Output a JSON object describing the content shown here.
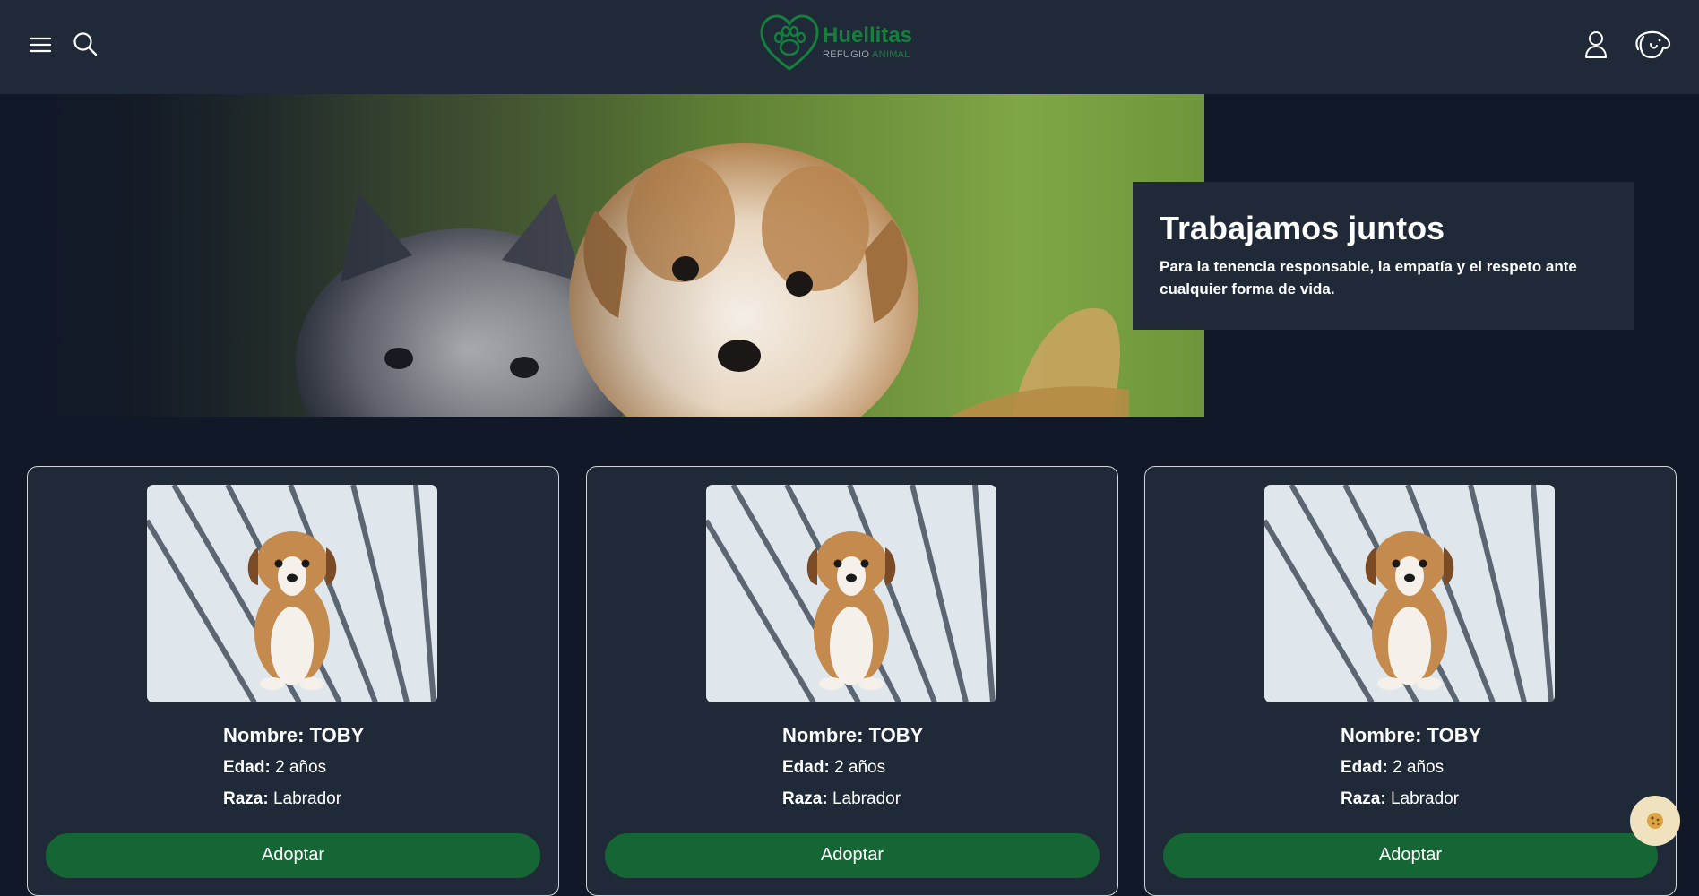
{
  "header": {
    "logo": {
      "title": "Huellitas",
      "subtitle_main": "REFUGIO",
      "subtitle_accent": "ANIMAL"
    },
    "icons": {
      "menu": "menu-icon",
      "search": "search-icon",
      "user": "user-icon",
      "pet": "dog-icon"
    }
  },
  "hero": {
    "title": "Trabajamos juntos",
    "text": "Para la tenencia responsable, la empatía y el respeto ante cualquier forma de vida."
  },
  "pets": [
    {
      "name_label": "Nombre: TOBY",
      "age_label": "Edad:",
      "age_value": "2 años",
      "breed_label": "Raza:",
      "breed_value": "Labrador",
      "button": "Adoptar"
    },
    {
      "name_label": "Nombre: TOBY",
      "age_label": "Edad:",
      "age_value": "2 años",
      "breed_label": "Raza:",
      "breed_value": "Labrador",
      "button": "Adoptar"
    },
    {
      "name_label": "Nombre: TOBY",
      "age_label": "Edad:",
      "age_value": "2 años",
      "breed_label": "Raza:",
      "breed_value": "Labrador",
      "button": "Adoptar"
    }
  ],
  "colors": {
    "page_bg": "#111827",
    "surface": "#1f2937",
    "brand_green": "#166534",
    "logo_green": "#15803d"
  },
  "cookie_icon": "cookie-icon"
}
